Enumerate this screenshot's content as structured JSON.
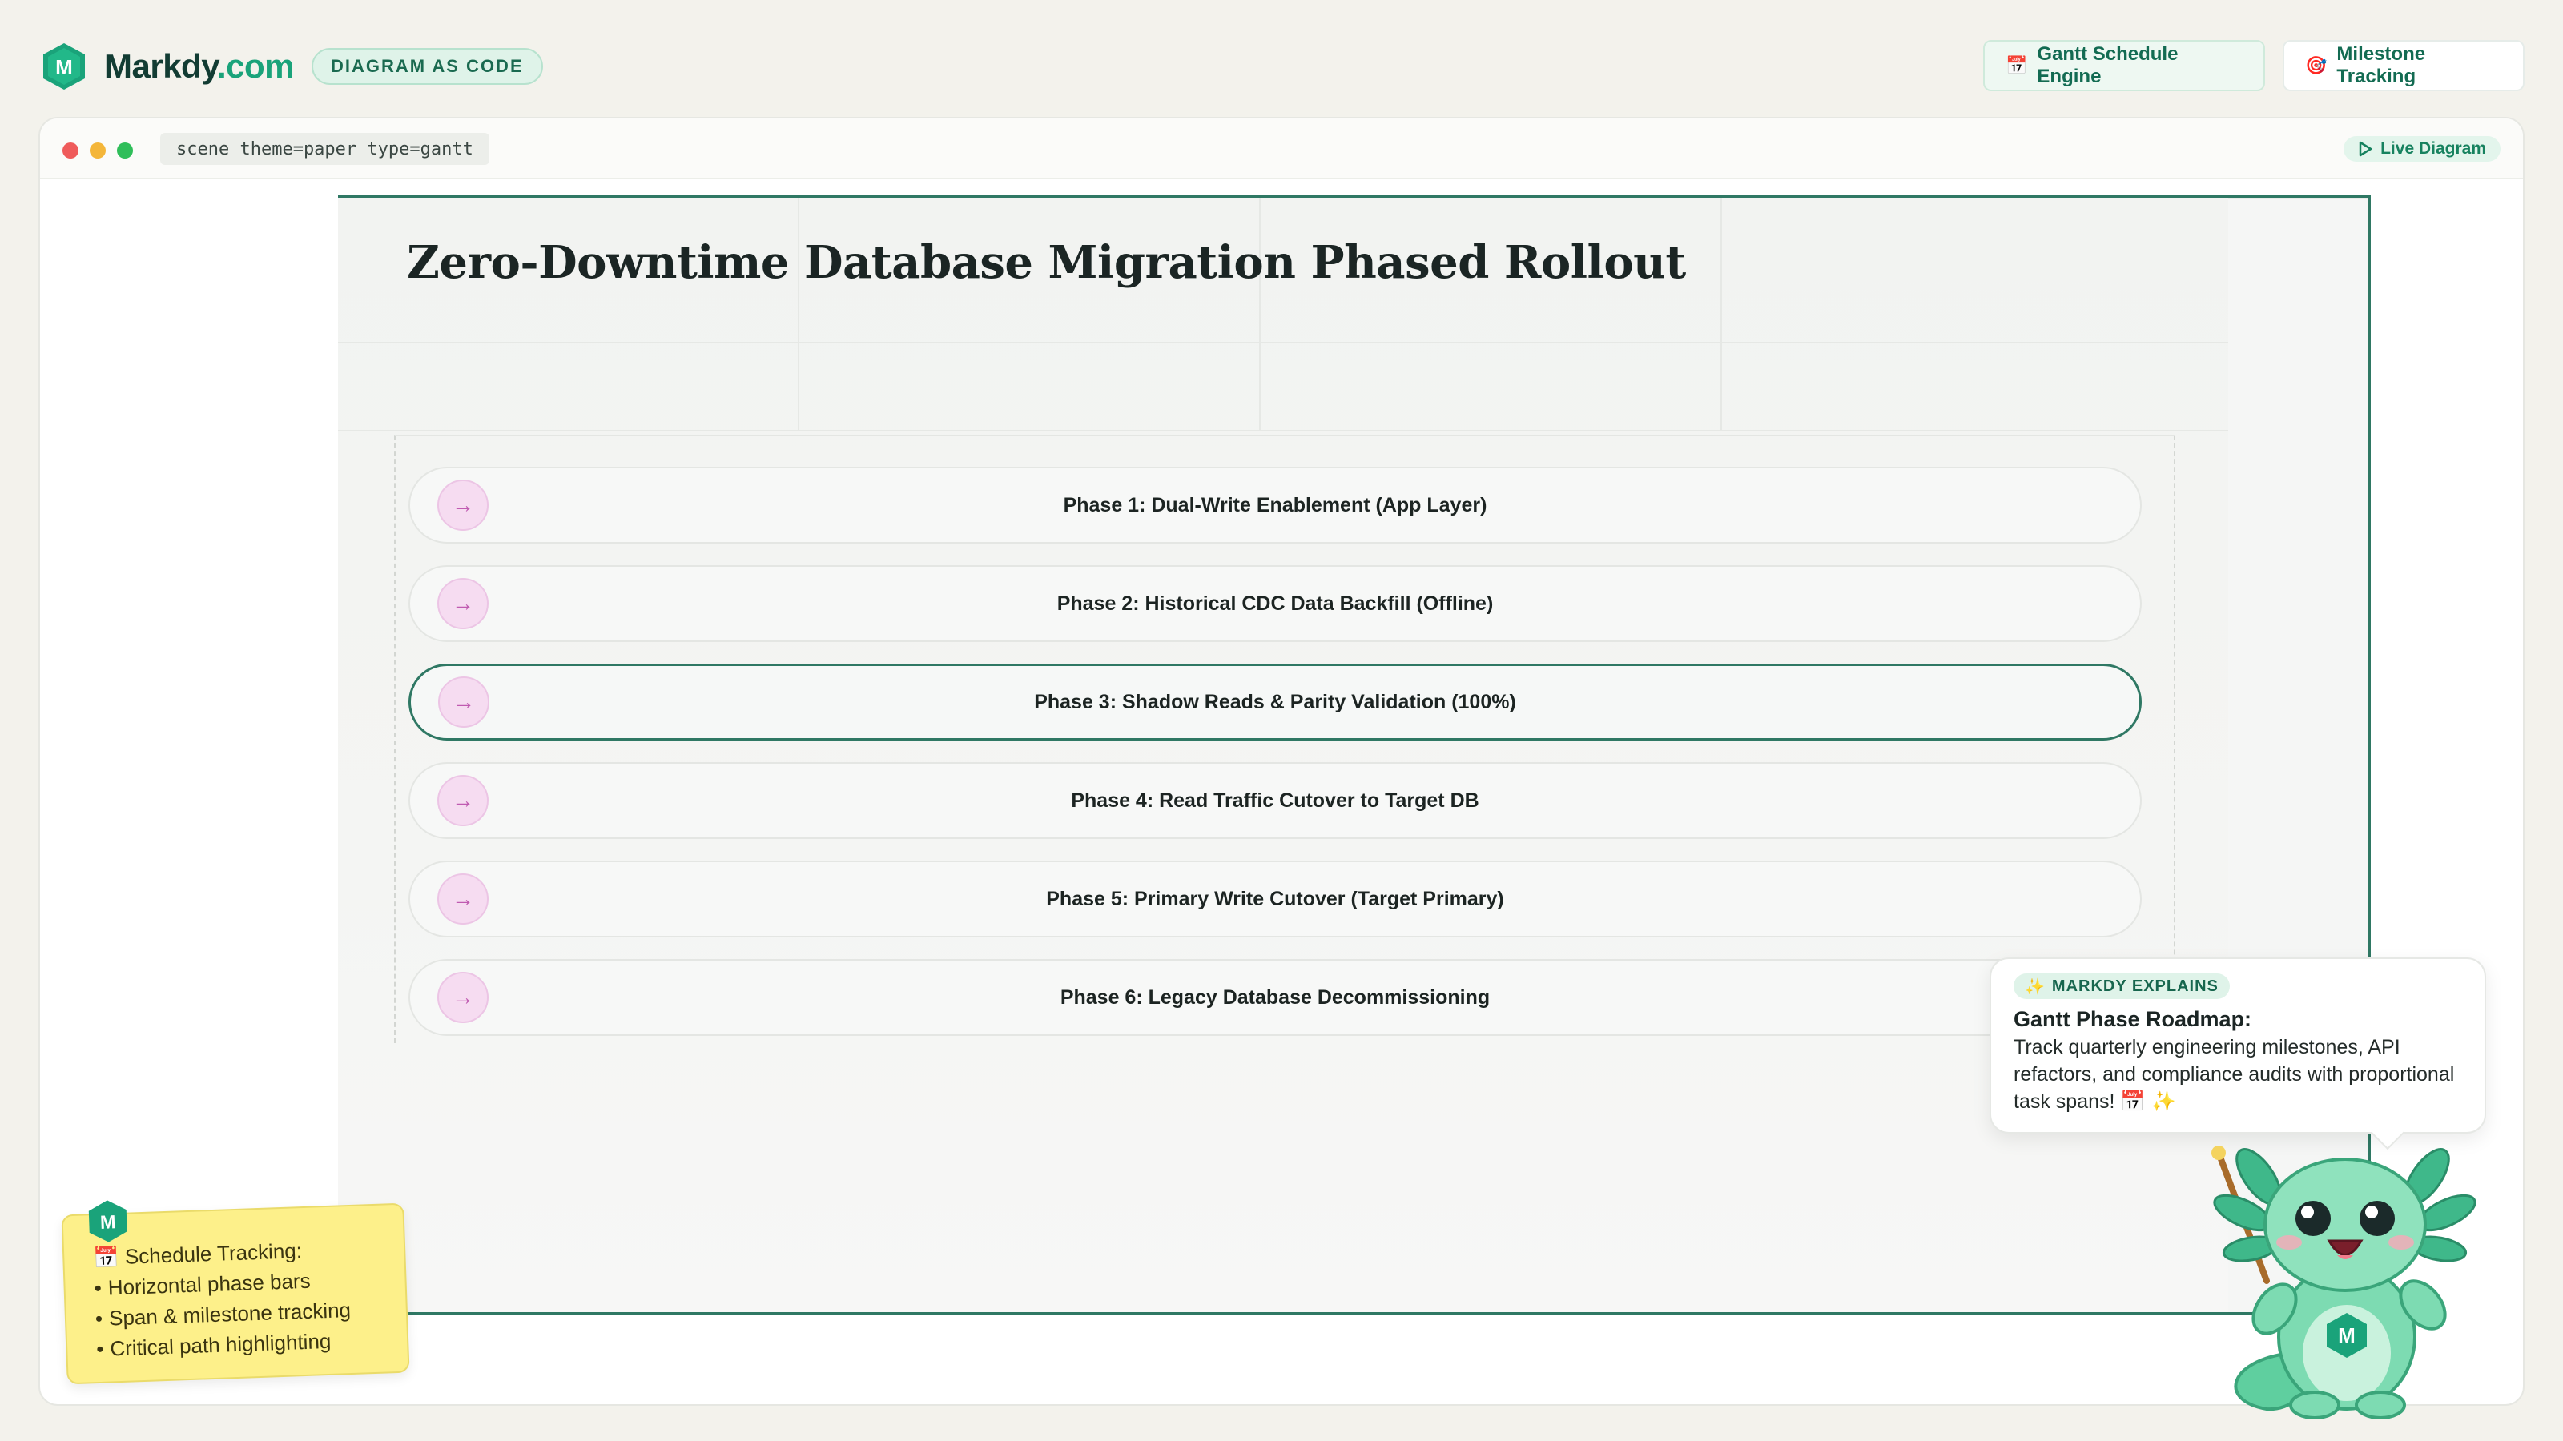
{
  "brand": {
    "name_main": "Markdy",
    "name_suffix": ".com",
    "badge": "DIAGRAM AS CODE",
    "logo_letter": "M"
  },
  "header": {
    "gantt_pill": {
      "icon": "📅",
      "label": "Gantt Schedule Engine"
    },
    "milestone_pill": {
      "icon": "🎯",
      "label": "Milestone Tracking"
    }
  },
  "window": {
    "scene_code": "scene theme=paper type=gantt",
    "live_label": "Live Diagram"
  },
  "diagram": {
    "title": "Zero-Downtime Database Migration Phased Rollout",
    "phases": [
      {
        "label": "Phase 1: Dual-Write Enablement (App Layer)",
        "active": false
      },
      {
        "label": "Phase 2: Historical CDC Data Backfill (Offline)",
        "active": false
      },
      {
        "label": "Phase 3: Shadow Reads & Parity Validation (100%)",
        "active": true
      },
      {
        "label": "Phase 4: Read Traffic Cutover to Target DB",
        "active": false
      },
      {
        "label": "Phase 5: Primary Write Cutover (Target Primary)",
        "active": false
      },
      {
        "label": "Phase 6: Legacy Database Decommissioning",
        "active": false
      }
    ],
    "phase_icon": "→"
  },
  "sticky": {
    "title": "📅 Schedule Tracking:",
    "items": [
      "Horizontal phase bars",
      "Span & milestone tracking",
      "Critical path highlighting"
    ]
  },
  "bubble": {
    "tag_icon": "✨",
    "tag": "MARKDY EXPLAINS",
    "title": "Gantt Phase Roadmap:",
    "body": "Track quarterly engineering milestones, API refactors, and compliance audits with proportional task spans! 📅 ✨"
  },
  "colors": {
    "brand_green": "#1aa37a",
    "frame_green": "#2f7864",
    "phase_icon_pink": "#f6dcf1",
    "sticky_yellow": "#fdf08a"
  }
}
